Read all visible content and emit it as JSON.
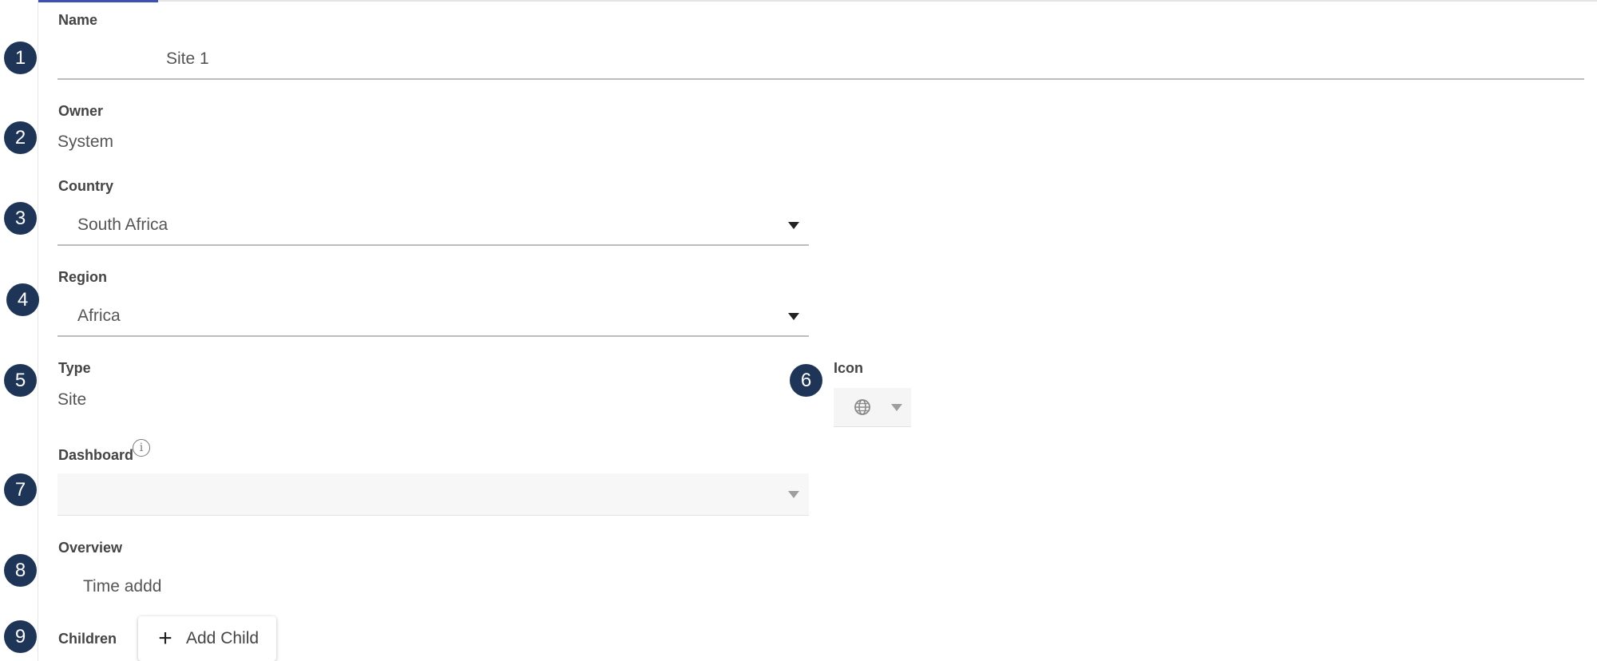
{
  "form": {
    "name": {
      "label": "Name",
      "value": "Site 1"
    },
    "owner": {
      "label": "Owner",
      "value": "System"
    },
    "country": {
      "label": "Country",
      "value": "South Africa"
    },
    "region": {
      "label": "Region",
      "value": "Africa"
    },
    "type": {
      "label": "Type",
      "value": "Site"
    },
    "icon": {
      "label": "Icon",
      "value_icon": "globe-icon"
    },
    "dashboard": {
      "label": "Dashboard",
      "value": "",
      "info_icon": "info-icon"
    },
    "overview": {
      "label": "Overview",
      "value": "Time addd"
    },
    "children": {
      "label": "Children",
      "add_button_label": "Add Child",
      "add_button_icon": "plus-icon"
    }
  },
  "badges": [
    "1",
    "2",
    "3",
    "4",
    "5",
    "6",
    "7",
    "8",
    "9"
  ],
  "colors": {
    "badge": "#1e3557",
    "accent": "#3f51b5",
    "underline": "#bdbdbd"
  }
}
